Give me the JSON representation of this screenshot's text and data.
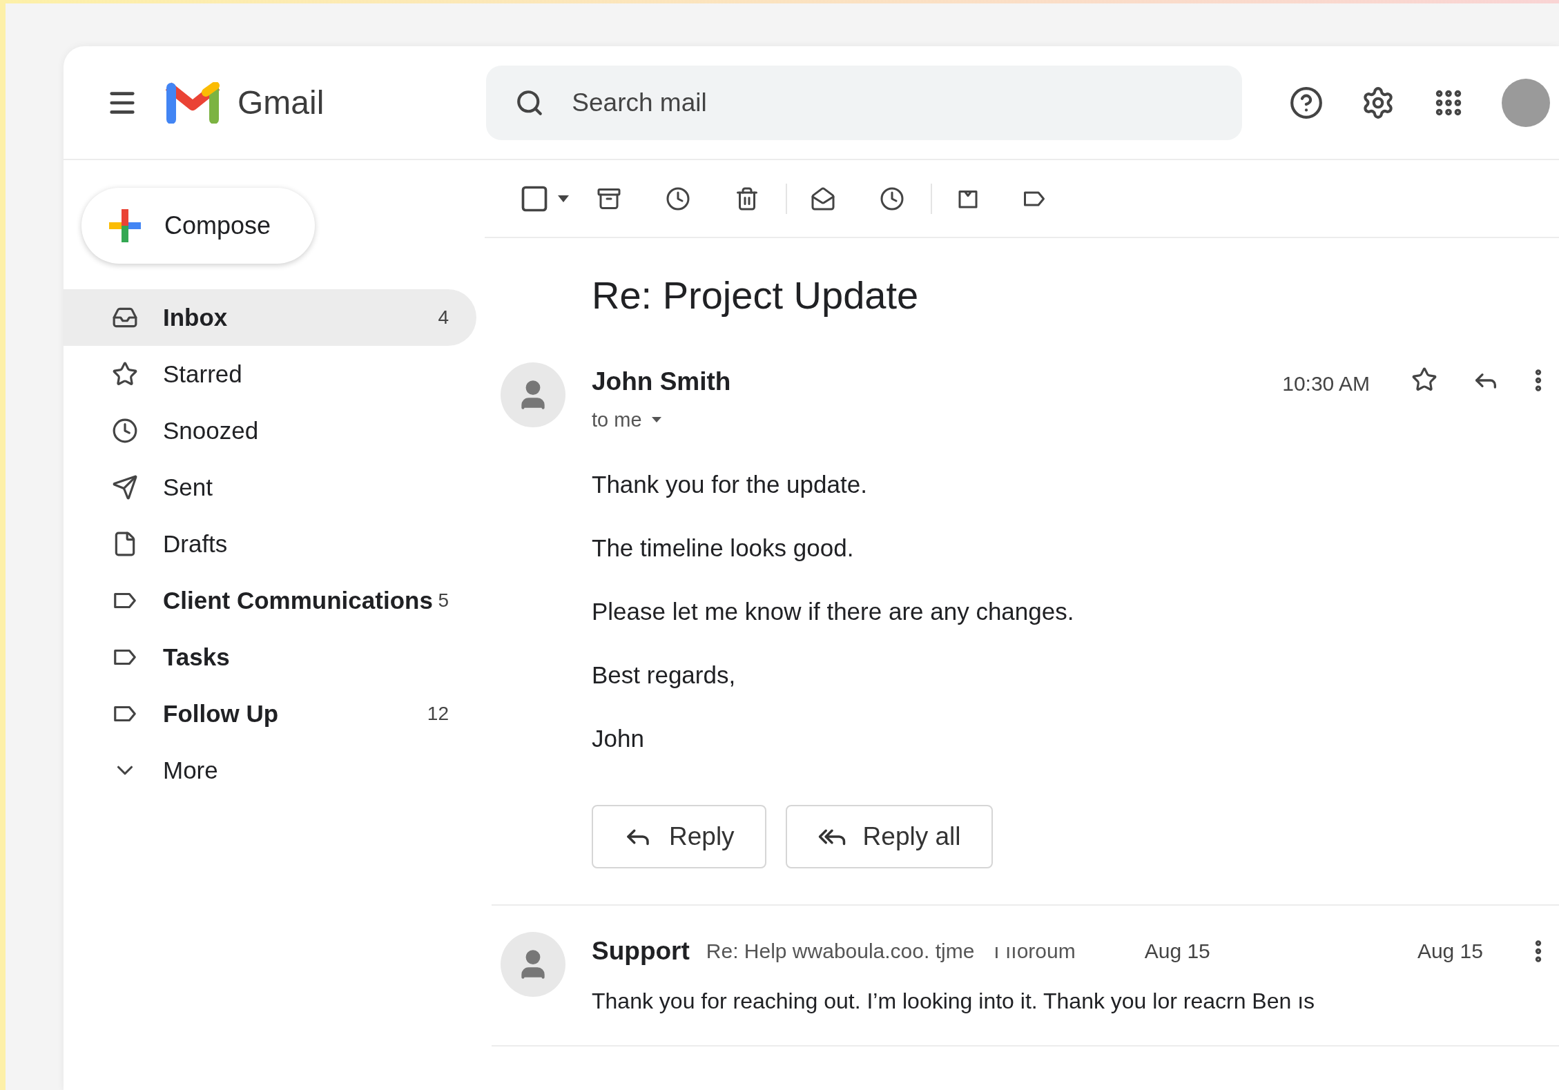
{
  "header": {
    "product_name": "Gmail",
    "search": {
      "placeholder": "Search mail"
    }
  },
  "compose_button": {
    "label": "Compose"
  },
  "nav": [
    {
      "kind": "inbox",
      "label": "Inbox",
      "count": "4",
      "unread": true,
      "selected": true
    },
    {
      "kind": "star",
      "label": "Starred",
      "unread": false,
      "selected": false
    },
    {
      "kind": "clock",
      "label": "Snoozed",
      "unread": false,
      "selected": false
    },
    {
      "kind": "send",
      "label": "Sent",
      "unread": false,
      "selected": false
    },
    {
      "kind": "file",
      "label": "Drafts",
      "unread": false,
      "selected": false
    },
    {
      "kind": "label",
      "label": "Client Communications",
      "count": "5",
      "unread": true,
      "selected": false
    },
    {
      "kind": "label",
      "label": "Tasks",
      "unread": true,
      "selected": false
    },
    {
      "kind": "label",
      "label": "Follow Up",
      "count": "12",
      "unread": true,
      "selected": false
    },
    {
      "kind": "more",
      "label": "More",
      "unread": false,
      "selected": false
    }
  ],
  "toolbar": {
    "select_checkbox": {
      "checked": false
    }
  },
  "thread": {
    "subject": "Re: Project Update",
    "message": {
      "sender": "John Smith",
      "recipient": "to me",
      "time": "10:30 AM",
      "starred": false,
      "paragraphs": [
        "Thank you for the update.",
        "The timeline looks good.",
        "Please let me know if there are any changes.",
        "Best regards,",
        "John"
      ]
    },
    "actions": [
      {
        "kind": "reply",
        "label": "Reply"
      },
      {
        "kind": "reply_all",
        "label": "Reply all"
      }
    ]
  },
  "conversations": [
    {
      "sender": "Support",
      "subject": "Re: Help wwaboula.coo. tjme",
      "subject_tail": "ı ııoroum",
      "date": "Aug 15",
      "date_2": "Aug 15",
      "snippet": "Thank you for reaching out. I’m looking into it.  Thank you lor reacrn Ben ıs"
    }
  ]
}
